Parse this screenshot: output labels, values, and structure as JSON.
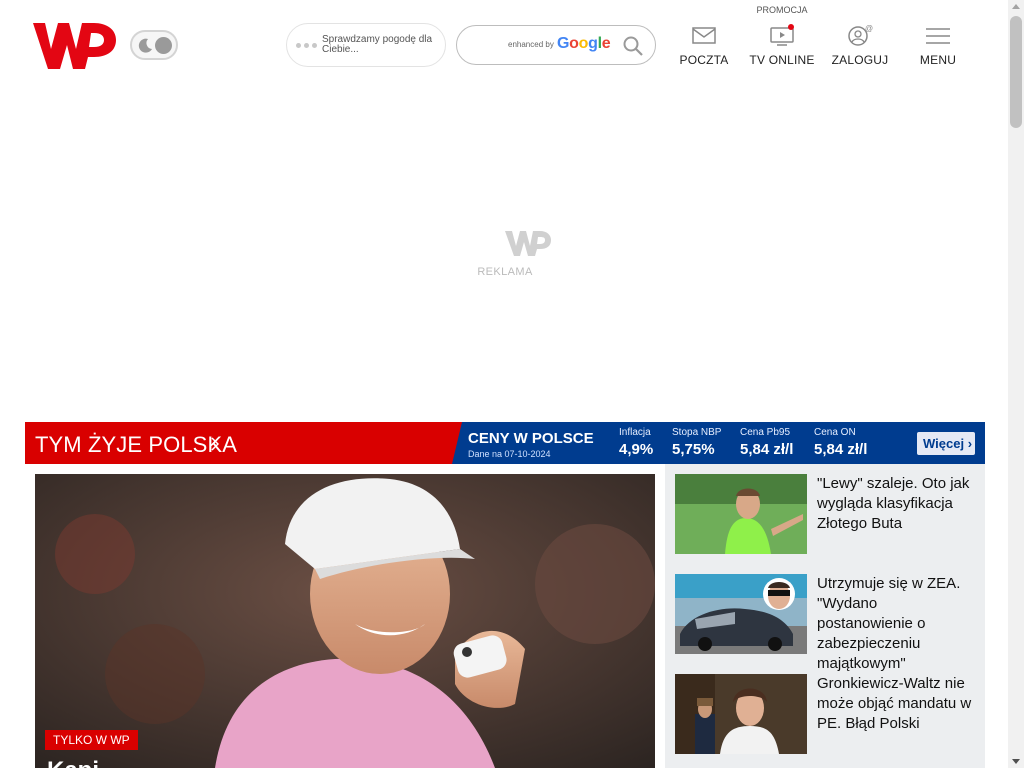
{
  "header": {
    "weather_text": "Sprawdzamy pogodę dla Ciebie...",
    "search": {
      "enhanced_by": "enhanced by",
      "provider": "Google"
    },
    "promo_label": "PROMOCJA",
    "nav": [
      {
        "label": "POCZTA",
        "icon": "mail-icon"
      },
      {
        "label": "TV ONLINE",
        "icon": "tv-icon"
      },
      {
        "label": "ZALOGUJ",
        "icon": "user-icon"
      },
      {
        "label": "MENU",
        "icon": "hamburger-icon"
      }
    ]
  },
  "ad": {
    "label": "REKLAMA"
  },
  "banner": {
    "section_title": "TYM ŻYJE POLSKA",
    "prices_title": "CENY W POLSCE",
    "prices_date": "Dane na 07-10-2024",
    "stats": [
      {
        "key": "Inflacja",
        "value": "4,9%"
      },
      {
        "key": "Stopa NBP",
        "value": "5,75%"
      },
      {
        "key": "Cena Pb95",
        "value": "5,84 zł/l"
      },
      {
        "key": "Cena ON",
        "value": "5,84 zł/l"
      }
    ],
    "more_label": "Więcej"
  },
  "hero": {
    "badge": "TYLKO W WP",
    "headline": "Kapi..."
  },
  "news": [
    {
      "title": "\"Lewy\" szaleje. Oto jak wygląda klasyfikacja Złotego Buta"
    },
    {
      "title": "Utrzymuje się w ZEA. \"Wydano postanowienie o zabezpieczeniu majątkowym\""
    },
    {
      "title": "Gronkiewicz-Waltz nie może objąć mandatu w PE. Błąd Polski"
    }
  ],
  "colors": {
    "brand_red": "#d90000",
    "navy": "#003c8f"
  }
}
